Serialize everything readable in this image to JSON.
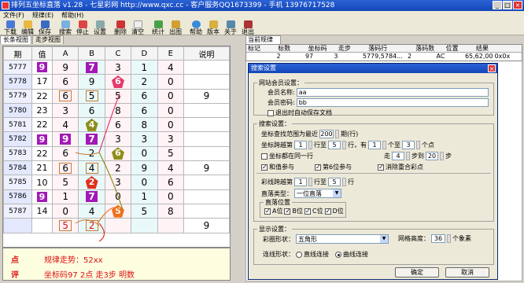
{
  "title": "排列五坐标直落 v1.28 - 七星彩网 http://www.qxc.cc - 客户服务QQ1673399 - 手机 13976717528",
  "menu": [
    "文件(F)",
    "规律(E)",
    "帮助(H)"
  ],
  "toolbar": [
    "下载",
    "编辑",
    "保存",
    "搜索",
    "停止",
    "设置",
    "删除",
    "清空",
    "统计",
    "出图",
    "帮助",
    "版本",
    "关于",
    "退出"
  ],
  "left_tabs": [
    "长条视图",
    "走步视图"
  ],
  "grid": {
    "headers": [
      "期",
      "值",
      "A",
      "B",
      "C",
      "D",
      "E",
      "说明"
    ],
    "rows": [
      {
        "period": "5777",
        "value": "9",
        "cells": [
          "9",
          "7",
          "3",
          "1",
          "4"
        ],
        "note": ""
      },
      {
        "period": "5778",
        "value": "17",
        "cells": [
          "6",
          "9",
          "6",
          "2",
          "0"
        ],
        "note": ""
      },
      {
        "period": "5779",
        "value": "22",
        "cells": [
          "6",
          "5",
          "5",
          "6",
          "0"
        ],
        "note": "9"
      },
      {
        "period": "5780",
        "value": "23",
        "cells": [
          "3",
          "6",
          "8",
          "6",
          "0"
        ],
        "note": ""
      },
      {
        "period": "5781",
        "value": "22",
        "cells": [
          "4",
          "4",
          "6",
          "8",
          "0"
        ],
        "note": ""
      },
      {
        "period": "5782",
        "value": "9",
        "cells": [
          "9",
          "7",
          "3",
          "3",
          "3"
        ],
        "note": ""
      },
      {
        "period": "5783",
        "value": "22",
        "cells": [
          "6",
          "2",
          "6",
          "0",
          "5"
        ],
        "note": ""
      },
      {
        "period": "5784",
        "value": "21",
        "cells": [
          "6",
          "4",
          "2",
          "9",
          "4"
        ],
        "note": "9"
      },
      {
        "period": "5785",
        "value": "10",
        "cells": [
          "5",
          "2",
          "3",
          "0",
          "6"
        ],
        "note": ""
      },
      {
        "period": "5786",
        "value": "9",
        "cells": [
          "1",
          "7",
          "0",
          "1",
          "0"
        ],
        "note": ""
      },
      {
        "period": "5787",
        "value": "14",
        "cells": [
          "0",
          "4",
          "5",
          "5",
          "8"
        ],
        "note": ""
      },
      {
        "period": "",
        "value": "",
        "cells": [
          "5",
          "2",
          "",
          "",
          ""
        ],
        "note": "9"
      }
    ]
  },
  "notes": {
    "label1": "点",
    "text1": "规律走势：52xx",
    "label2": "评",
    "text2": "坐标码97 2点 走3步 明数"
  },
  "right_tab": "当前规律",
  "rule_table": {
    "headers": [
      "标记",
      "标数",
      "坐标码",
      "走步",
      "落码行",
      "落码数",
      "位置",
      "结果"
    ],
    "row": [
      "",
      "2",
      "97",
      "3",
      "5779,5784...",
      "2",
      "AC",
      "65,62,00",
      "0x0x"
    ]
  },
  "dialog": {
    "title": "搜索设置",
    "member_group": "网站会员设置：",
    "member_name_label": "会员名称:",
    "member_name_value": "aa",
    "member_pwd_label": "会员密码:",
    "member_pwd_value": "bb",
    "autosave_label": "退出时自动保存文档",
    "search_group": "搜索设置：",
    "range_prefix": "坐标查找范围为最近",
    "range_value": "200",
    "range_suffix": "期(行)",
    "row_span_prefix": "坐标跨越第",
    "row_span_from": "1",
    "row_span_mid": "行至",
    "row_span_to": "5",
    "row_span_suffix": "行，有",
    "count_from": "1",
    "count_mid": "个至",
    "count_to": "3",
    "count_suffix": "个点",
    "same_row_label": "坐标都在同一行",
    "walk_prefix": "走",
    "walk_from": "4",
    "walk_mid": "步到",
    "walk_to": "20",
    "walk_suffix": "步",
    "opt_sum": "和值参与",
    "opt_sixth": "第6位参与",
    "opt_dedupe": "消除重合彩点",
    "color_span_prefix": "彩线跨越第",
    "color_from": "1",
    "color_mid": "行至",
    "color_to": "5",
    "color_suffix": "行",
    "drop_type_label": "直落类型：",
    "drop_type_value": "一位直落",
    "drop_pos_label": "直落位置",
    "pos_a": "A位",
    "pos_b": "B位",
    "pos_c": "C位",
    "pos_d": "D位",
    "display_group": "显示设置：",
    "shape_label": "彩圈形状：",
    "shape_value": "五角形",
    "grid_height_label": "网格高度：",
    "grid_height_value": "36",
    "grid_height_unit": "个象素",
    "line_shape_label": "连线形状：",
    "line_straight": "直线连接",
    "line_curve": "曲线连接",
    "ok": "确定",
    "cancel": "取消"
  },
  "colors": {
    "purple": "#a218b8",
    "pink": "#e53a6b",
    "olive": "#8e8e1a",
    "red": "#e0301e",
    "orange": "#f07018",
    "brown": "#c87a32"
  }
}
